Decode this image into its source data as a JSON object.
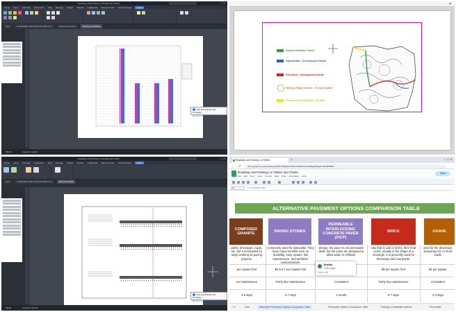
{
  "cad": {
    "file_title": "Roadway and Parking Lot Details and Charts",
    "window_controls": "— ☐ ✕",
    "menu": [
      "Home",
      "Insert",
      "Annotate",
      "Parametric",
      "View",
      "Manage",
      "Output",
      "Add-ins",
      "Collaborate",
      "Express Tools",
      "Featured Apps",
      "Layout"
    ],
    "active_menu": "Layout",
    "tabs_q1": [
      "Start",
      "OVERSIZED AND CODE MASTER V1.0",
      "Selected Pavement",
      "Parking Lot Drawing"
    ],
    "tabs_q3": [
      "Start",
      "OVERSIZED AND CODE MASTER V1.0",
      "Pavement Detail"
    ],
    "status_left": "Model",
    "status_right": "Layout1  Layout2",
    "toast_title": "Plot and Publish Job Complete",
    "toast_body": "No errors or warnings found",
    "toast_link": "Click to view plot and publish details..."
  },
  "pdf_legend": [
    {
      "label": "Double Infiltration Trench",
      "color": "#2e9e3a",
      "style": "box"
    },
    {
      "label": "Impermeable - Decomposed Granite",
      "color": "#1f5fd4",
      "style": "box"
    },
    {
      "label": "Pea Gravel - Decomposed Granite",
      "color": "#d42020",
      "style": "box"
    },
    {
      "label": "Parking Village Gardens - To stay Asphalt",
      "color": "#e07a16",
      "style": "circle"
    },
    {
      "label": "Proposed Driveway Path - Fill Path",
      "color": "#e8e812",
      "style": "box"
    }
  ],
  "browser": {
    "tab_title": "Roadway and Parking Lot Tables",
    "url": "docs.google.com/spreadsheets/d/1bTdhgJ6VsVb9zUwPJ8Vm2wJcE8g/edit#gid=1624550824",
    "doc_title": "Roadway and Parking Lot Tables and Charts",
    "menu": [
      "File",
      "Edit",
      "View",
      "Insert",
      "Format",
      "Data",
      "Tools",
      "Extensions",
      "Help"
    ],
    "share_label": "Share",
    "name_box": "A1",
    "formula": "fx  Comment only"
  },
  "sheet": {
    "banner": "ALTERNATIVE PAVEMENT OPTIONS COMPARISON TABLE",
    "columns": [
      {
        "header": "COMPOSED GRANITE",
        "color": "#7a3e1a",
        "desc": "paths, driveways, roads, etc. but it is intended for large working lot paving projects.",
        "cost": "per square foot",
        "maint": "ow maintenance",
        "time": "3-5 days"
      },
      {
        "header": "PAVING STONES",
        "color": "#8e7cc3",
        "desc": "Commonly used for sidewalks. They have many benefits such as durability, easy repairs, low maintenance, and aesthetic customizations.",
        "cost": "$2.5-3.7 per square foot",
        "maint": "Fairly low maintenance",
        "time": "5-7 days"
      },
      {
        "header": "PERMEABLE INTERLOCKING CONCRETE PAVER (PICP)",
        "color": "#8e7cc3",
        "desc": "design, the paver is not permeable itself, but the joints are designed to allow water to infiltrate.",
        "cost": "",
        "maint": "Consistent",
        "time": "1 month"
      },
      {
        "header": "BRICK",
        "color": "#c62a1a",
        "desc": "clay that is cast in forms, then heat cured, usually in the shape of a rectangle. It is generally used for driveways and courtyards.",
        "cost": "$8 per square foot",
        "maint": "Fairly low maintenance",
        "time": "5-7 days"
      },
      {
        "header": "GRAVE",
        "color": "#b45f06",
        "desc": "used for the driveways, temporary lot, or short roads.",
        "cost": "$1 per square",
        "maint": "Consistent",
        "time": "2-3 days"
      }
    ],
    "popup_name": "Bradley",
    "popup_status": "Free today",
    "popup_hint": "Edit on ⌘"
  },
  "sheet_tabs": [
    "Intro",
    "Alternative Pavement Options Comparison Table",
    "Permeable Options Comparison Table",
    "Parking Lot Materials Options",
    "Permeable"
  ],
  "active_sheet_tab": "Alternative Pavement Options Comparison Table"
}
